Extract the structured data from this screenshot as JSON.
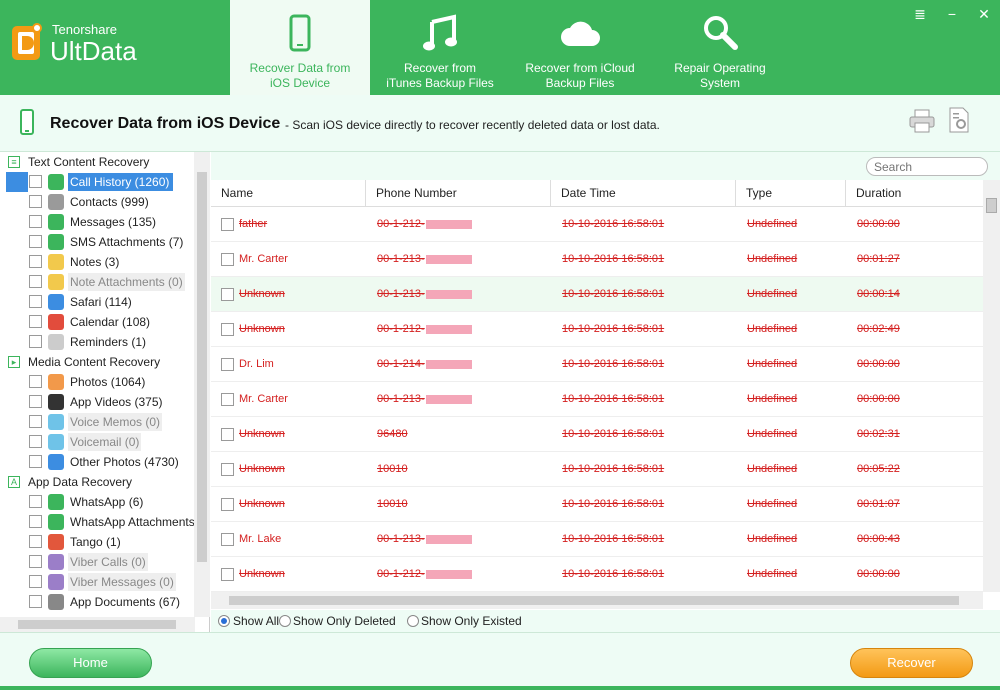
{
  "app": {
    "vendor": "Tenorshare",
    "name": "UltData",
    "accent_color": "#3cb55c"
  },
  "tabs": [
    {
      "label_line1": "Recover Data from",
      "label_line2": "iOS Device",
      "icon": "phone-icon",
      "active": true
    },
    {
      "label_line1": "Recover from",
      "label_line2": "iTunes Backup Files",
      "icon": "music-note-icon",
      "active": false
    },
    {
      "label_line1": "Recover from iCloud",
      "label_line2": "Backup Files",
      "icon": "cloud-icon",
      "active": false
    },
    {
      "label_line1": "Repair Operating",
      "label_line2": "System",
      "icon": "wrench-icon",
      "active": false
    }
  ],
  "window_controls": {
    "menu": "≣",
    "minimize": "−",
    "close": "✕"
  },
  "subheader": {
    "title": "Recover Data from iOS Device",
    "description": "- Scan iOS device directly to recover recently deleted data or lost data."
  },
  "tree": {
    "categories": [
      {
        "label": "Text Content Recovery",
        "items": [
          {
            "label": "Call History (1260)",
            "icon": "phone-call-icon",
            "color": "#3cb55c",
            "selected": true,
            "disabled": false
          },
          {
            "label": "Contacts (999)",
            "icon": "contacts-icon",
            "color": "#9a9a9a",
            "selected": false,
            "disabled": false
          },
          {
            "label": "Messages (135)",
            "icon": "messages-icon",
            "color": "#3cb55c",
            "selected": false,
            "disabled": false
          },
          {
            "label": "SMS Attachments (7)",
            "icon": "paperclip-icon",
            "color": "#3cb55c",
            "selected": false,
            "disabled": false
          },
          {
            "label": "Notes (3)",
            "icon": "notes-icon",
            "color": "#f2c94c",
            "selected": false,
            "disabled": false
          },
          {
            "label": "Note Attachments (0)",
            "icon": "note-attachment-icon",
            "color": "#f2c94c",
            "selected": false,
            "disabled": true
          },
          {
            "label": "Safari (114)",
            "icon": "safari-icon",
            "color": "#3c8de1",
            "selected": false,
            "disabled": false
          },
          {
            "label": "Calendar (108)",
            "icon": "calendar-icon",
            "color": "#e24c3c",
            "selected": false,
            "disabled": false
          },
          {
            "label": "Reminders (1)",
            "icon": "reminders-icon",
            "color": "#cccccc",
            "selected": false,
            "disabled": false
          }
        ]
      },
      {
        "label": "Media Content Recovery",
        "items": [
          {
            "label": "Photos (1064)",
            "icon": "photos-icon",
            "color": "#f2994a",
            "selected": false,
            "disabled": false
          },
          {
            "label": "App Videos (375)",
            "icon": "clapperboard-icon",
            "color": "#333333",
            "selected": false,
            "disabled": false
          },
          {
            "label": "Voice Memos (0)",
            "icon": "voice-memo-icon",
            "color": "#6fc3e8",
            "selected": false,
            "disabled": true
          },
          {
            "label": "Voicemail (0)",
            "icon": "voicemail-icon",
            "color": "#6fc3e8",
            "selected": false,
            "disabled": true
          },
          {
            "label": "Other Photos (4730)",
            "icon": "landscape-icon",
            "color": "#3c8de1",
            "selected": false,
            "disabled": false
          }
        ]
      },
      {
        "label": "App Data Recovery",
        "items": [
          {
            "label": "WhatsApp (6)",
            "icon": "whatsapp-icon",
            "color": "#3cb55c",
            "selected": false,
            "disabled": false
          },
          {
            "label": "WhatsApp Attachments (",
            "icon": "paperclip-icon",
            "color": "#3cb55c",
            "selected": false,
            "disabled": false
          },
          {
            "label": "Tango (1)",
            "icon": "tango-icon",
            "color": "#e2573c",
            "selected": false,
            "disabled": false
          },
          {
            "label": "Viber Calls (0)",
            "icon": "viber-icon",
            "color": "#9b7ec8",
            "selected": false,
            "disabled": true
          },
          {
            "label": "Viber Messages (0)",
            "icon": "viber-icon",
            "color": "#9b7ec8",
            "selected": false,
            "disabled": true
          },
          {
            "label": "App Documents (67)",
            "icon": "document-icon",
            "color": "#888888",
            "selected": false,
            "disabled": false
          }
        ]
      }
    ]
  },
  "search": {
    "placeholder": "Search"
  },
  "table": {
    "columns": [
      "Name",
      "Phone Number",
      "Date Time",
      "Type",
      "Duration"
    ],
    "rows": [
      {
        "name": "father",
        "name_deleted": true,
        "phone": "00-1-212-",
        "phone_blurred": true,
        "datetime": "10-10-2016 16:58:01",
        "type": "Undefined",
        "duration": "00:00:00",
        "highlight": false
      },
      {
        "name": "Mr. Carter",
        "name_deleted": false,
        "phone": "00-1-213-",
        "phone_blurred": true,
        "datetime": "10-10-2016 16:58:01",
        "type": "Undefined",
        "duration": "00:01:27",
        "highlight": false
      },
      {
        "name": "Unknown",
        "name_deleted": true,
        "phone": "00-1-213-",
        "phone_blurred": true,
        "datetime": "10-10-2016 16:58:01",
        "type": "Undefined",
        "duration": "00:00:14",
        "highlight": true
      },
      {
        "name": "Unknown",
        "name_deleted": true,
        "phone": "00-1-212-",
        "phone_blurred": true,
        "datetime": "10-10-2016 16:58:01",
        "type": "Undefined",
        "duration": "00:02:49",
        "highlight": false
      },
      {
        "name": "Dr. Lim",
        "name_deleted": false,
        "phone": "00-1-214-",
        "phone_blurred": true,
        "datetime": "10-10-2016 16:58:01",
        "type": "Undefined",
        "duration": "00:00:00",
        "highlight": false
      },
      {
        "name": "Mr. Carter",
        "name_deleted": false,
        "phone": "00-1-213-",
        "phone_blurred": true,
        "datetime": "10-10-2016 16:58:01",
        "type": "Undefined",
        "duration": "00:00:00",
        "highlight": false
      },
      {
        "name": "Unknown",
        "name_deleted": true,
        "phone": "96480",
        "phone_blurred": false,
        "datetime": "10-10-2016 16:58:01",
        "type": "Undefined",
        "duration": "00:02:31",
        "highlight": false
      },
      {
        "name": "Unknown",
        "name_deleted": true,
        "phone": "10010",
        "phone_blurred": false,
        "datetime": "10-10-2016 16:58:01",
        "type": "Undefined",
        "duration": "00:05:22",
        "highlight": false
      },
      {
        "name": "Unknown",
        "name_deleted": true,
        "phone": "10010",
        "phone_blurred": false,
        "datetime": "10-10-2016 16:58:01",
        "type": "Undefined",
        "duration": "00:01:07",
        "highlight": false
      },
      {
        "name": "Mr. Lake",
        "name_deleted": false,
        "phone": "00-1-213-",
        "phone_blurred": true,
        "datetime": "10-10-2016 16:58:01",
        "type": "Undefined",
        "duration": "00:00:43",
        "highlight": false
      },
      {
        "name": "Unknown",
        "name_deleted": true,
        "phone": "00-1-212-",
        "phone_blurred": true,
        "datetime": "10-10-2016 16:58:01",
        "type": "Undefined",
        "duration": "00:00:00",
        "highlight": false
      }
    ]
  },
  "filters": [
    {
      "label": "Show All",
      "selected": true
    },
    {
      "label": "Show Only Deleted",
      "selected": false
    },
    {
      "label": "Show Only Existed",
      "selected": false
    }
  ],
  "buttons": {
    "home": "Home",
    "recover": "Recover"
  }
}
